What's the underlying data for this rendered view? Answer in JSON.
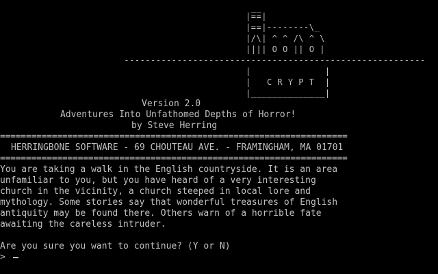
{
  "colors": {
    "background": "#000000",
    "text": "#c0c0c0"
  },
  "logo": {
    "lines": [
      "                                                __",
      "                                               |==|",
      "                                               |==|--------\\_",
      "                                               |/\\| ^ ^ /\\ ^ \\",
      "                                               |||| O O || O |",
      "                        ---------------------------------------------------------",
      "                                               |              |",
      "                                               |   C R Y P T  |",
      "                                               |______________|"
    ]
  },
  "header": {
    "version": "Version 2.0",
    "subtitle": "Adventures Into Unfathomed Depths of Horror!",
    "author": "by Steve Herring"
  },
  "publisher": {
    "rule_top": "===================================================================",
    "text": "HERRINGBONE SOFTWARE - 69 CHOUTEAU AVE. - FRAMINGHAM, MA 01701",
    "rule_bottom": "==================================================================="
  },
  "intro": {
    "lines": [
      "You are taking a walk in the English countryside. It is an area",
      "unfamiliar to you, but you have heard of a very interesting",
      "church in the vicinity, a church steeped in local lore and",
      "mythology. Some stories say that wonderful treasures of English",
      "antiquity may be found there. Others warn of a horrible fate",
      "awaiting the careless intruder."
    ]
  },
  "question": "Are you sure you want to continue? (Y or N)",
  "prompt": {
    "symbol": ">",
    "value": ""
  }
}
